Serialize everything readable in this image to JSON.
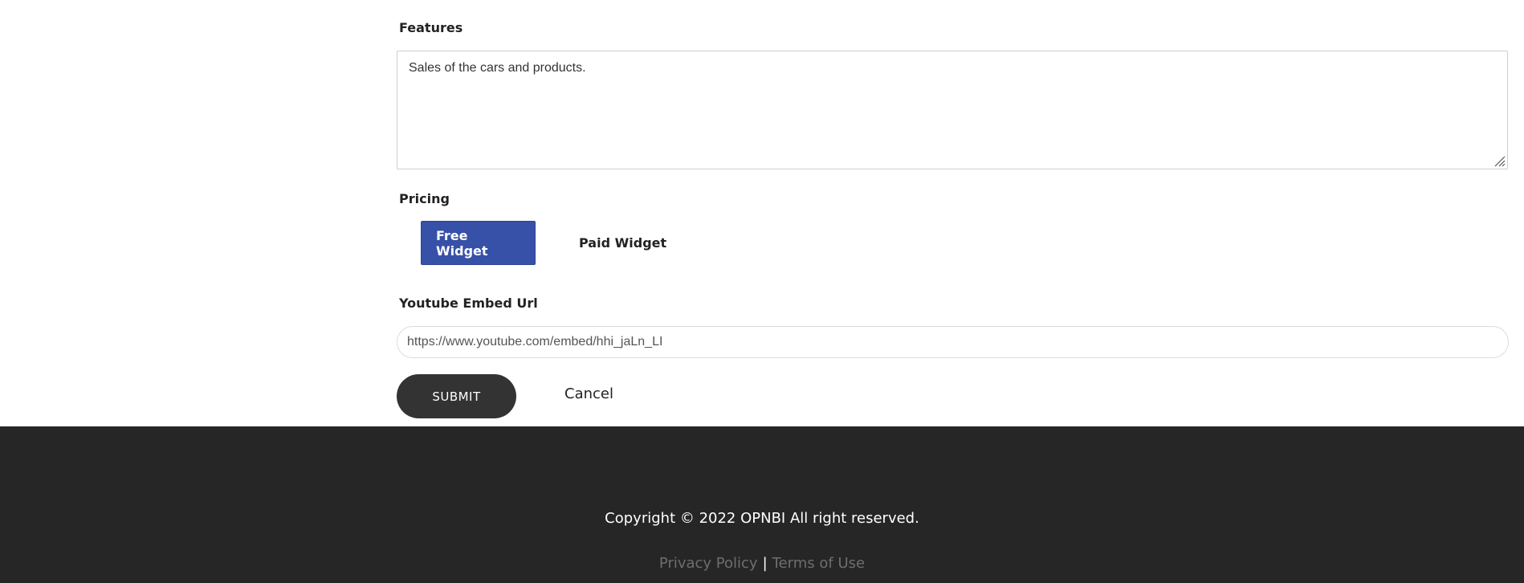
{
  "form": {
    "features": {
      "label": "Features",
      "value": "Sales of the cars and products."
    },
    "pricing": {
      "label": "Pricing",
      "options": [
        {
          "label": "Free Widget",
          "selected": true
        },
        {
          "label": "Paid Widget",
          "selected": false
        }
      ]
    },
    "youtube": {
      "label": "Youtube Embed Url",
      "value": "https://www.youtube.com/embed/hhi_jaLn_LI"
    },
    "submit_label": "SUBMIT",
    "cancel_label": "Cancel"
  },
  "footer": {
    "copyright": "Copyright © 2022 OPNBI All right reserved.",
    "links": {
      "privacy": "Privacy Policy",
      "separator": "|",
      "terms": "Terms of Use"
    }
  },
  "colors": {
    "accent": "#3751a8",
    "submit_bg": "#333333",
    "footer_bg": "#262626",
    "footer_link": "#6e6e6e"
  }
}
